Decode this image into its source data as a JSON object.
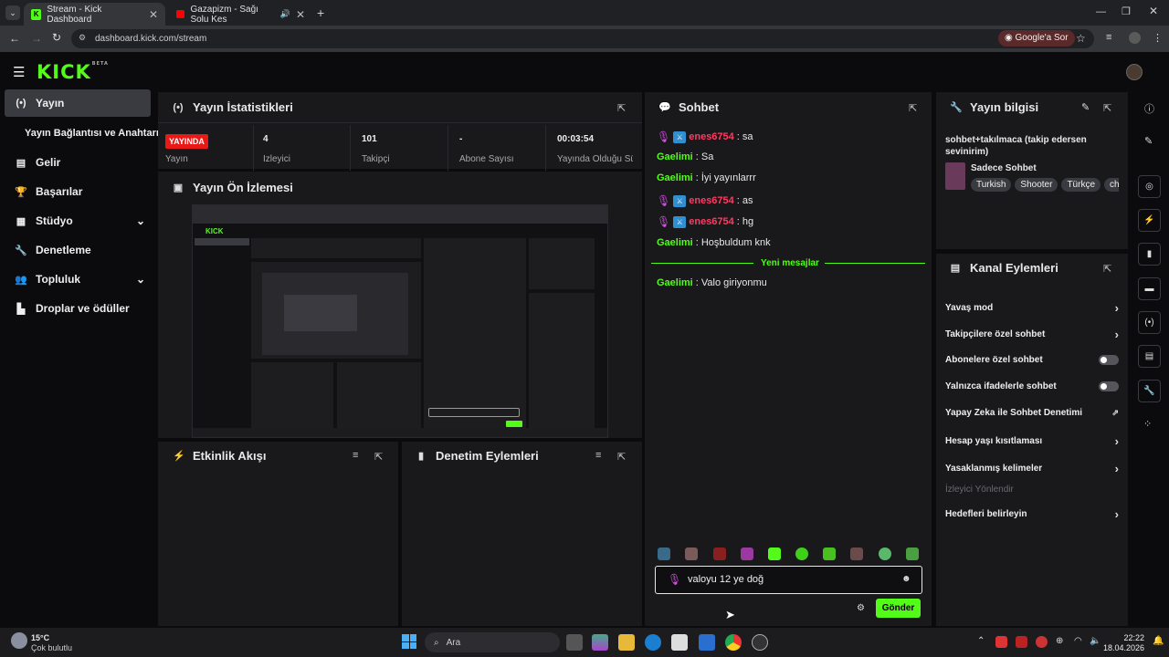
{
  "browser": {
    "tabs": [
      {
        "title": "Stream - Kick Dashboard"
      },
      {
        "title": "Gazapizm - Sağı Solu Kes"
      }
    ],
    "url": "dashboard.kick.com/stream",
    "google_btn": "Google'a Sor"
  },
  "kick": {
    "logo": "KICK",
    "logo_badge": "BETA"
  },
  "sidebar": {
    "items": [
      {
        "label": "Yayın",
        "icon": "broadcast-icon"
      },
      {
        "label": "Yayın Bağlantısı ve Anahtarı"
      },
      {
        "label": "Gelir",
        "icon": "wallet-icon"
      },
      {
        "label": "Başarılar",
        "icon": "trophy-icon"
      },
      {
        "label": "Stüdyo",
        "icon": "studio-icon"
      },
      {
        "label": "Denetleme",
        "icon": "wrench-icon"
      },
      {
        "label": "Topluluk",
        "icon": "community-icon"
      },
      {
        "label": "Droplar ve ödüller",
        "icon": "drops-icon"
      }
    ]
  },
  "stats": {
    "title": "Yayın İstatistikleri",
    "live_badge": "YAYINDA",
    "live_label": "Yayın",
    "cells": [
      {
        "value": "4",
        "label": "İzleyici"
      },
      {
        "value": "101",
        "label": "Takipçi"
      },
      {
        "value": "-",
        "label": "Abone Sayısı"
      },
      {
        "value": "00:03:54",
        "label": "Yayında Olduğu Süre"
      }
    ]
  },
  "preview": {
    "title": "Yayın Ön İzlemesi"
  },
  "activity": {
    "title": "Etkinlik Akışı"
  },
  "mod_actions": {
    "title": "Denetim Eylemleri"
  },
  "chat": {
    "title": "Sohbet",
    "messages": [
      {
        "user": "enes6754",
        "text": ": sa",
        "style": "red"
      },
      {
        "user": "Gaelimi",
        "text": ": Sa",
        "style": "green"
      },
      {
        "user": "Gaelimi",
        "text": ": İyi yayınlarrr",
        "style": "green"
      },
      {
        "user": "enes6754",
        "text": ": as",
        "style": "red"
      },
      {
        "user": "enes6754",
        "text": ": hg",
        "style": "red"
      },
      {
        "user": "Gaelimi",
        "text": ": Hoşbuldum knk",
        "style": "green"
      }
    ],
    "new_messages": "Yeni mesajlar",
    "after": {
      "user": "Gaelimi",
      "text": ": Valo giriyonmu"
    },
    "input_value": "valoyu 12 ye doğ",
    "send": "Gönder"
  },
  "stream_info": {
    "title": "Yayın bilgisi",
    "stream_title": "sohbet+takılmaca (takip edersen sevinirim)",
    "category": "Sadece Sohbet",
    "tags": [
      "Turkish",
      "Shooter",
      "Türkçe",
      "ch"
    ]
  },
  "channel_actions": {
    "title": "Kanal Eylemleri",
    "rows": [
      {
        "label": "Yavaş mod",
        "control": "chevron"
      },
      {
        "label": "Takipçilere özel sohbet",
        "control": "chevron"
      },
      {
        "label": "Abonelere özel sohbet",
        "control": "toggle"
      },
      {
        "label": "Yalnızca ifadelerle sohbet",
        "control": "toggle"
      },
      {
        "label": "Yapay Zeka ile Sohbet Denetimi",
        "control": "external"
      },
      {
        "label": "Hesap yaşı kısıtlaması",
        "control": "chevron"
      },
      {
        "label": "Yasaklanmış kelimeler",
        "control": "chevron"
      },
      {
        "label": "İzleyici Yönlendir",
        "control": "disabled"
      },
      {
        "label": "Hedefleri belirleyin",
        "control": "chevron"
      }
    ]
  },
  "taskbar": {
    "weather_temp": "15°C",
    "weather_text": "Çok bulutlu",
    "search": "Ara",
    "time": "22:22",
    "date": "18.04.2026"
  },
  "colors": {
    "accent": "#53fc18",
    "live": "#e91916",
    "username_red": "#ff3b62",
    "mic": "#d44ee3"
  }
}
